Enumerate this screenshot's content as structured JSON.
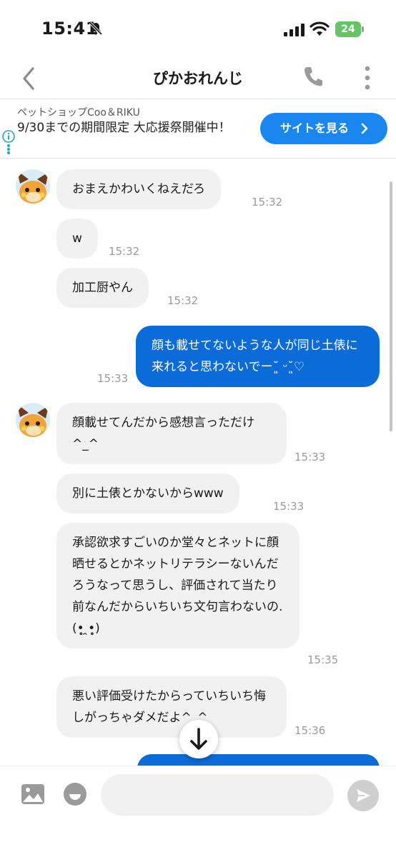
{
  "status_bar": {
    "time": "15:41",
    "battery": "24"
  },
  "header": {
    "title": "ぴかおれんじ"
  },
  "ad": {
    "source": "ペットショップCoo＆RIKU",
    "text": "9/30までの期間限定 大応援祭開催中！",
    "button_label": "サイトを見る"
  },
  "messages": [
    {
      "direction": "in",
      "text": "おまえかわいくねえだろ",
      "time": "15:32"
    },
    {
      "direction": "in",
      "text": "w",
      "time": "15:32"
    },
    {
      "direction": "in",
      "text": "加工厨やん",
      "time": "15:32"
    },
    {
      "direction": "out",
      "text": "顔も載せてないような人が同じ土俵に来れると思わないでー˘͈ ᵕ˘͈♡",
      "time": "15:33"
    },
    {
      "direction": "in",
      "text": "顔載せてんだから感想言っただけ^_^",
      "time": "15:33"
    },
    {
      "direction": "in",
      "text": "別に土俵とかないからwww",
      "time": "15:33"
    },
    {
      "direction": "in",
      "text": "承認欲求すごいのか堂々とネットに顔晒せるとかネットリテラシーないんだろうなって思うし、評価されて当たり前なんだからいちいち文句言わないの.(•̥̥̥ ̯•̥̥̥)",
      "time": "15:35"
    },
    {
      "direction": "in",
      "text": "悪い評価受けたからっていちいち悔しがっちゃダメだよ^_^",
      "time": "15:36"
    }
  ],
  "input": {
    "placeholder": ""
  },
  "colors": {
    "accent": "#1a86f0",
    "outgoing_bubble": "#0b6bd8",
    "incoming_bubble": "#f1f1f1"
  }
}
